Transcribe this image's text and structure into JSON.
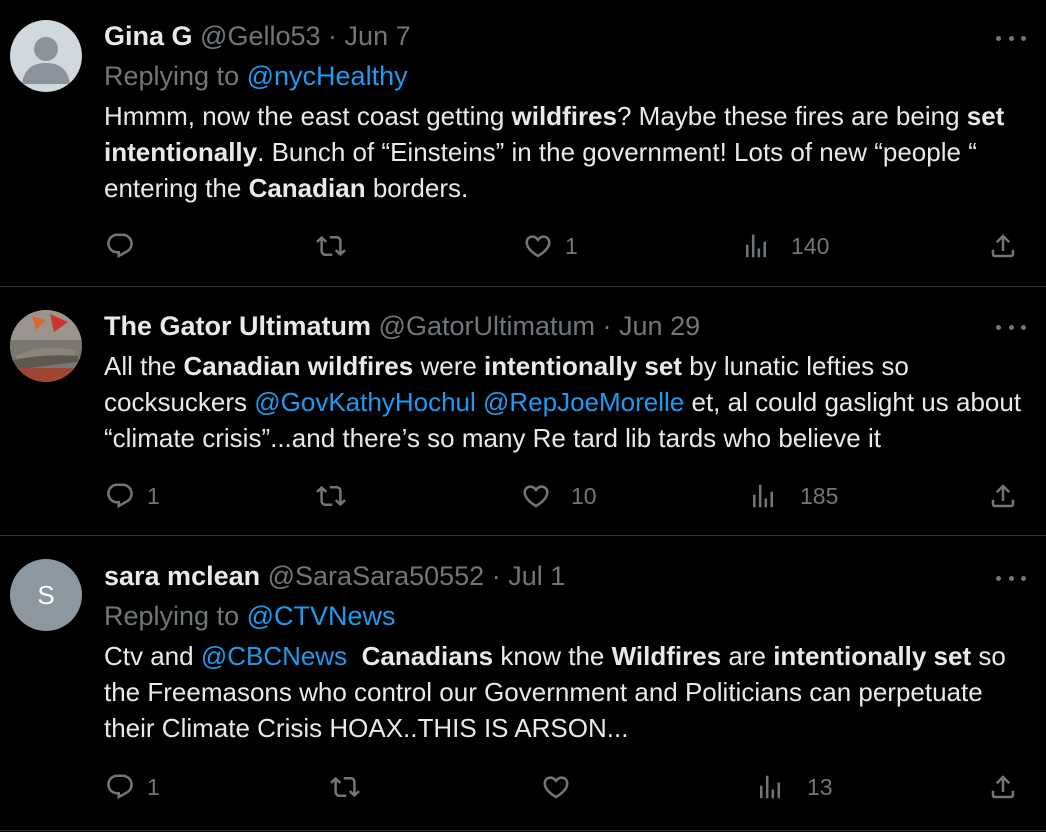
{
  "tweets": [
    {
      "display_name": "Gina G",
      "handle": "@Gello53",
      "dot": "·",
      "date": "Jun 7",
      "replying_prefix": "Replying to",
      "replying_to": "@nycHealthy",
      "avatar_icon": "default-profile-icon",
      "body": {
        "t1": "Hmmm, now the east coast getting ",
        "b1": "wildfires",
        "t2": "? Maybe these fires are being ",
        "b2": "set intentionally",
        "t3": ". Bunch of “Einsteins” in the government! Lots of new “people “ entering the ",
        "b3": "Canadian",
        "t4": " borders."
      },
      "replies": "",
      "retweets": "",
      "likes": "1",
      "views": "140"
    },
    {
      "display_name": "The Gator Ultimatum",
      "handle": "@GatorUltimatum",
      "dot": "·",
      "date": "Jun 29",
      "avatar_icon": "alligator-photo-icon",
      "body": {
        "t1": "All the ",
        "b1": "Canadian wildfires",
        "t2": " were ",
        "b2": "intentionally set",
        "t3": " by lunatic lefties so cocksuckers ",
        "m1": "@GovKathyHochul",
        "t4": " ",
        "m2": "@RepJoeMorelle",
        "t5": " et, al could gaslight us about “climate crisis”...and there’s so many Re tard lib tards who believe it"
      },
      "replies": "1",
      "retweets": "",
      "likes": "10",
      "views": "185"
    },
    {
      "display_name": "sara mclean",
      "handle": "@SaraSara50552",
      "dot": "·",
      "date": "Jul 1",
      "replying_prefix": "Replying to",
      "replying_to": "@CTVNews",
      "avatar_initial": "S",
      "body": {
        "t1": "Ctv and ",
        "m1": "@CBCNews",
        "t2": "  ",
        "b1": "Canadians",
        "t3": " know the ",
        "b2": "Wildfires",
        "t4": " are ",
        "b3": "intentionally set",
        "t5": " so the Freemasons who control our Government and Politicians can perpetuate their Climate Crisis HOAX..THIS IS ARSON..."
      },
      "replies": "1",
      "retweets": "",
      "likes": "",
      "views": "13"
    }
  ],
  "icons": {
    "reply": "reply-icon",
    "retweet": "retweet-icon",
    "like": "like-icon",
    "views": "views-icon",
    "share": "share-icon",
    "more": "more-icon"
  },
  "colors": {
    "background": "#000000",
    "text": "#e7e9ea",
    "muted": "#71767b",
    "link": "#1d9bf0",
    "divider": "#2f3336"
  }
}
